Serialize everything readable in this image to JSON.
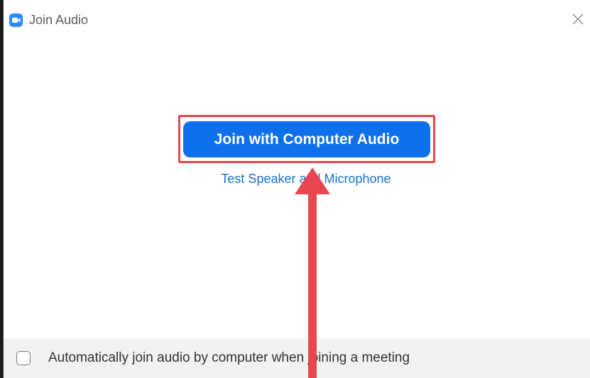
{
  "window": {
    "title": "Join Audio",
    "app_icon": "zoom-camera-icon",
    "close_icon": "close-icon"
  },
  "main": {
    "join_button_label": "Join with Computer Audio",
    "test_link_label": "Test Speaker and Microphone"
  },
  "footer": {
    "auto_join_label": "Automatically join audio by computer when joining a meeting",
    "auto_join_checked": false
  },
  "colors": {
    "brand_blue": "#0e71eb",
    "link_blue": "#1a73c9",
    "annotation_red": "#e8474f"
  }
}
